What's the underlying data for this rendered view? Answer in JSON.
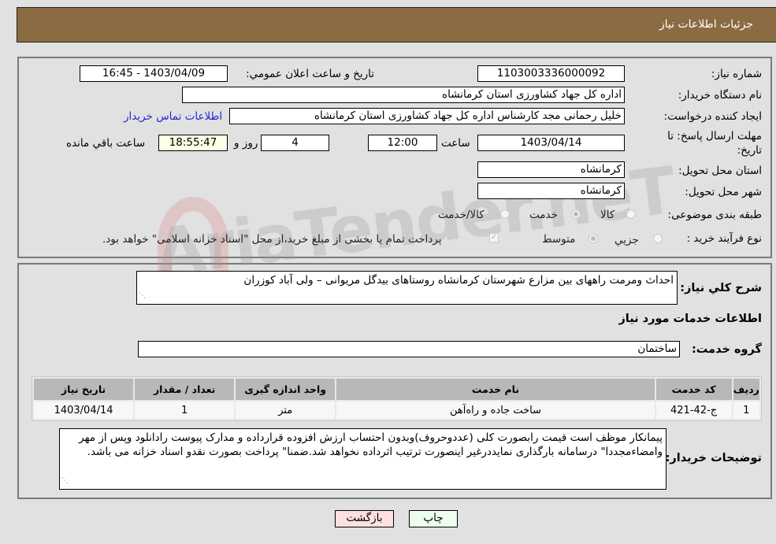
{
  "header": {
    "title": "جزئيات اطلاعات نياز"
  },
  "form": {
    "need_number_label": "شماره نياز:",
    "need_number": "1103003336000092",
    "announce_label": "تاريخ و ساعت اعلان عمومي:",
    "announce_value": "1403/04/09 - 16:45",
    "buyer_org_label": "نام دستگاه خريدار:",
    "buyer_org": "اداره کل جهاد کشاورزی استان کرمانشاه",
    "requester_label": "ايجاد کننده درخواست:",
    "requester": "خلیل رحمانی مجد کارشناس اداره کل جهاد کشاورزی استان کرمانشاه",
    "buyer_contact_link": "اطلاعات تماس خريدار",
    "deadline_label": "مهلت ارسال پاسخ: تا تاريخ:",
    "deadline_date": "1403/04/14",
    "time_label": "ساعت",
    "deadline_time": "12:00",
    "days": "4",
    "days_label": "روز و",
    "remaining_time": "18:55:47",
    "remaining_label": "ساعت باقي مانده",
    "province_label": "استان محل تحويل:",
    "province": "کرمانشاه",
    "city_label": "شهر محل تحويل:",
    "city": "کرمانشاه",
    "category_label": "طبقه بندی موضوعی:",
    "category_options": [
      "کالا",
      "خدمت",
      "کالا/خدمت"
    ],
    "category_selected": "خدمت",
    "process_label": "نوع فرآيند خريد :",
    "process_options": [
      "جزيي",
      "متوسط"
    ],
    "process_selected": "متوسط",
    "treasury_note": "پرداخت تمام يا بخشی از مبلغ خريد،از محل \"اسناد خزانه اسلامی\" خواهد بود.",
    "treasury_checked": true
  },
  "details": {
    "description_label": "شرح کلي نياز:",
    "description": "احداث ومرمت راههای بین مزارع شهرستان کرمانشاه روستاهای بیدگل مریوانی – ولی آباد کوزران",
    "services_title": "اطلاعات خدمات مورد نياز",
    "service_group_label": "گروه خدمت:",
    "service_group": "ساختمان",
    "table": {
      "headers": [
        "رديف",
        "کد خدمت",
        "نام خدمت",
        "واحد اندازه گيری",
        "تعداد / مقدار",
        "تاريخ نياز"
      ],
      "rows": [
        [
          "1",
          "ج-42-421",
          "ساخت جاده و راه‌آهن",
          "متر",
          "1",
          "1403/04/14"
        ]
      ]
    },
    "buyer_notes_label": "توضيحات خريدار:",
    "buyer_notes": "پیمانکار موظف است قیمت رابصورت کلی (عددوحروف)وبدون احتساب ارزش افزوده قرارداده و مدارک پیوست رادانلود وپس از مهر وامضاءمجددا\" درسامانه بارگذاری نمایددرغیر اینصورت ترتیب اثرداده نخواهد شد.ضمنا\" پرداخت بصورت نقدو اسناد خزانه می باشد."
  },
  "buttons": {
    "print": "چاپ",
    "back": "بازگشت"
  },
  "watermark": "AriaTender.neT"
}
